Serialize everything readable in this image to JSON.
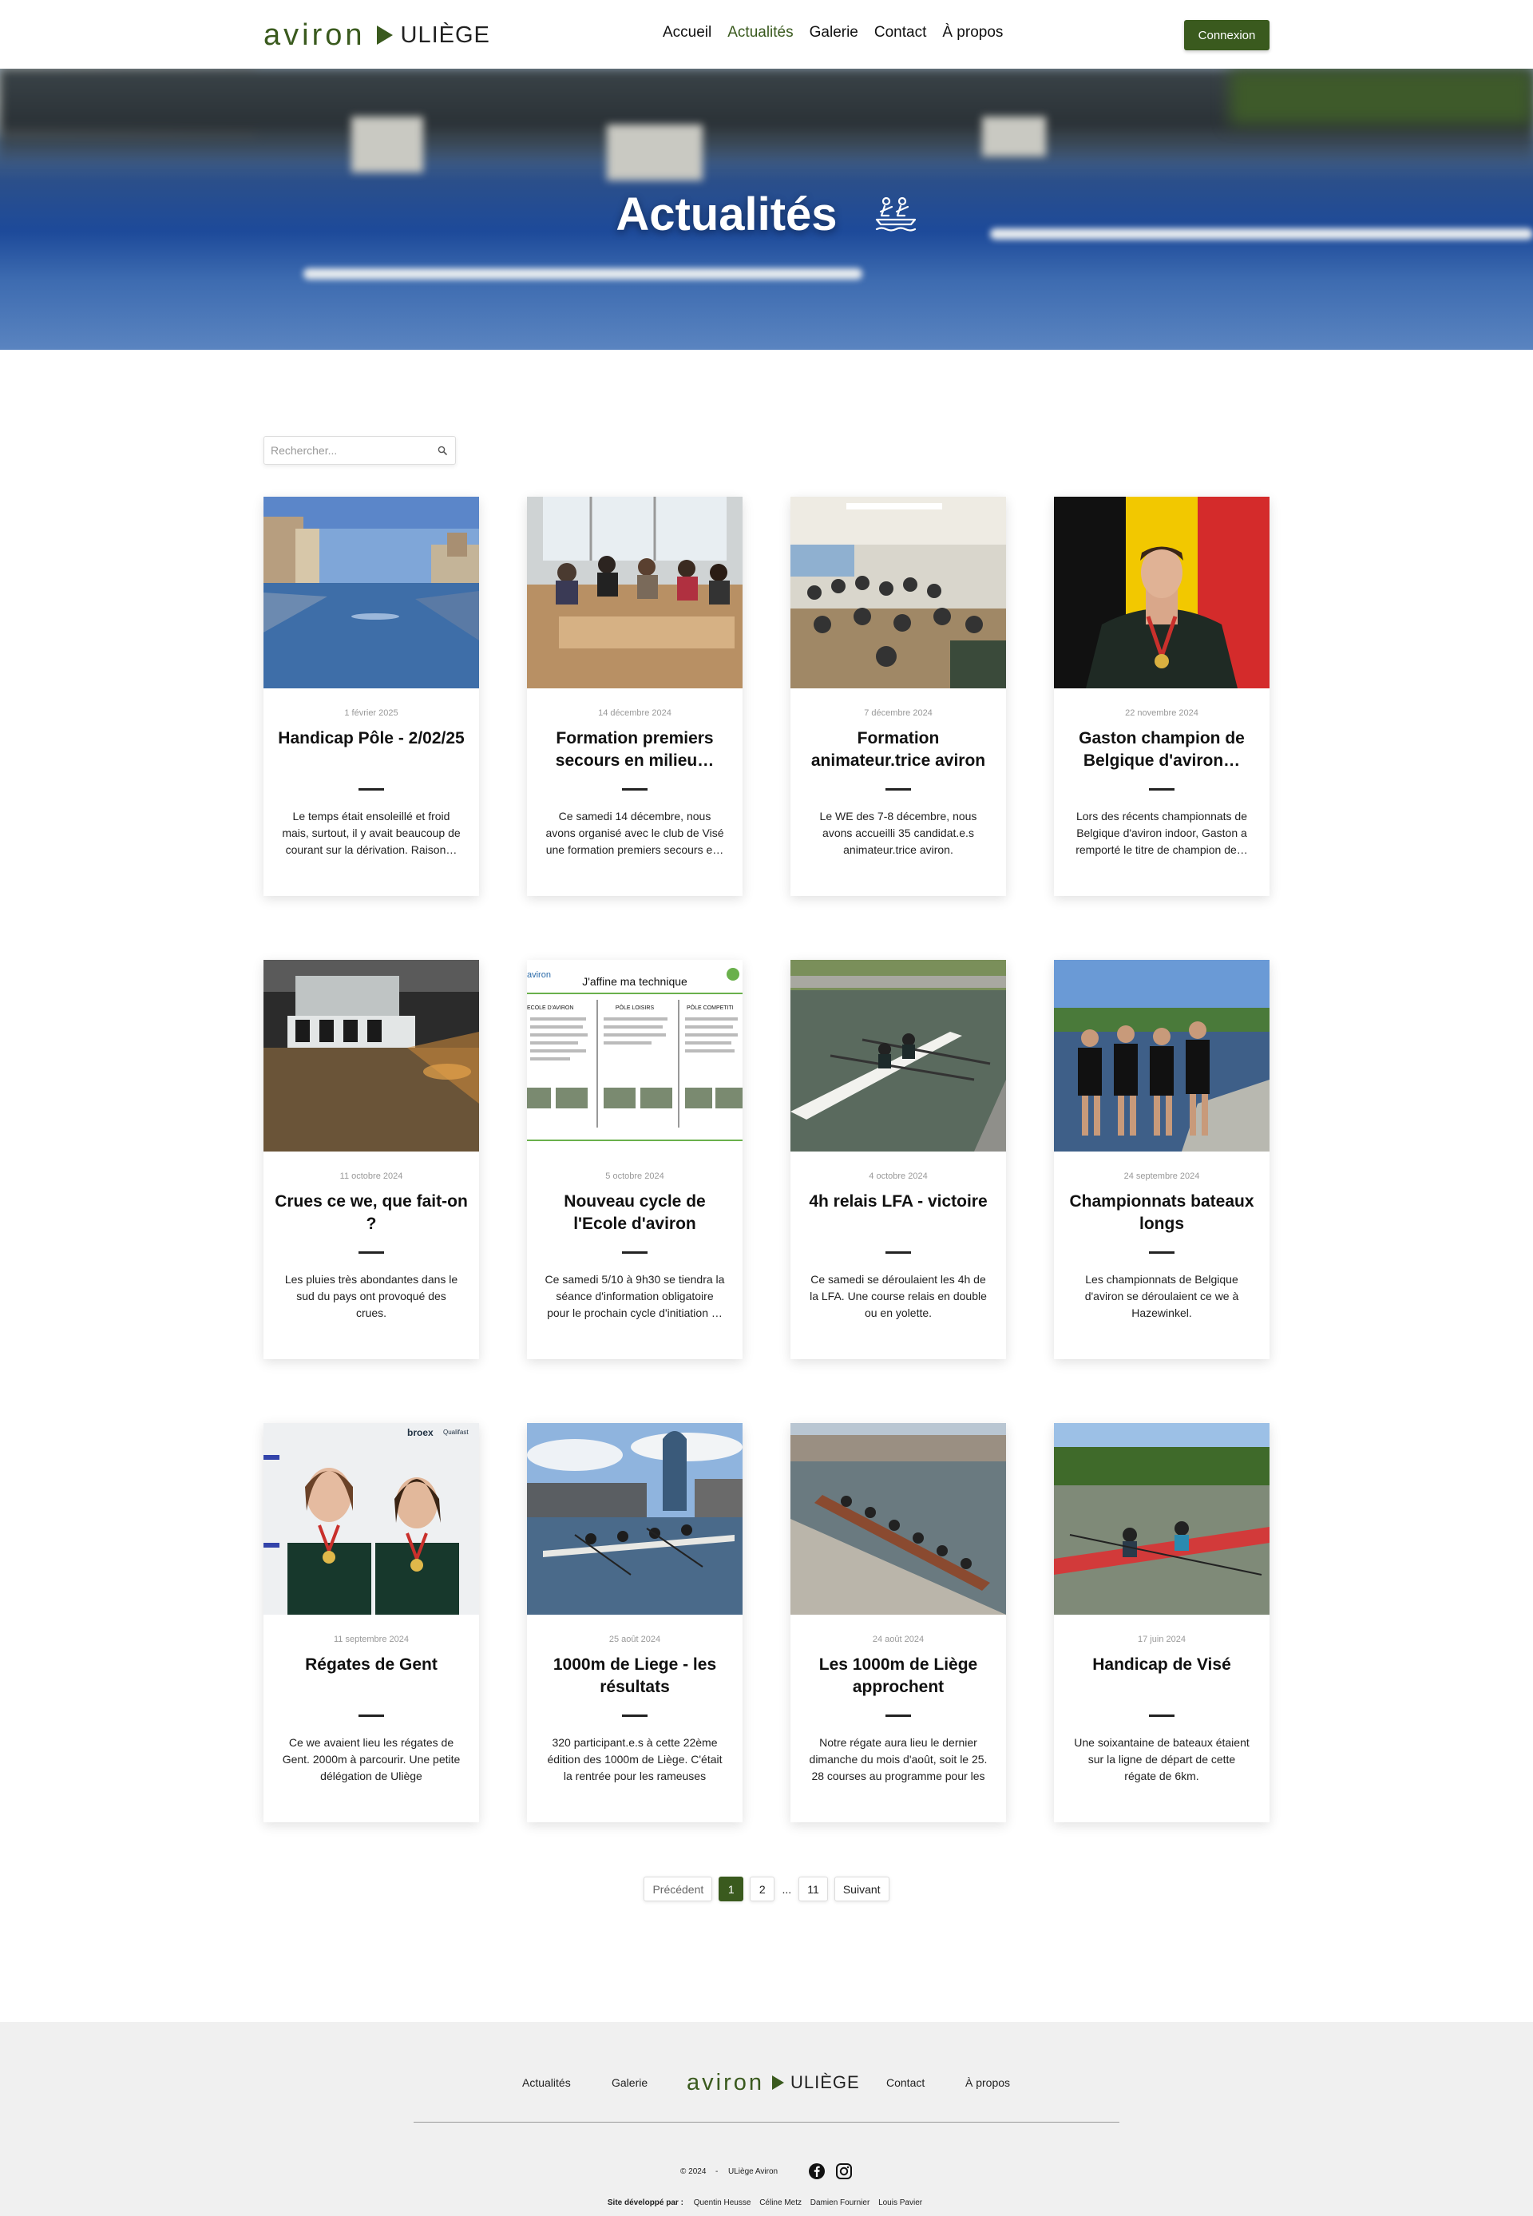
{
  "header": {
    "logo_main": "aviron",
    "logo_sub": "ULIÈGE",
    "nav": [
      "Accueil",
      "Actualités",
      "Galerie",
      "Contact",
      "À propos"
    ],
    "active_nav": "Actualités",
    "login_label": "Connexion"
  },
  "hero": {
    "title": "Actualités",
    "icon": "rowing-boat-icon"
  },
  "search": {
    "placeholder": "Rechercher..."
  },
  "articles": [
    {
      "date": "1 février 2025",
      "title": "Handicap Pôle - 2/02/25",
      "excerpt": "Le temps était ensoleillé et froid mais, surtout, il y avait beaucoup de courant sur la dérivation. Raison…"
    },
    {
      "date": "14 décembre 2024",
      "title": "Formation premiers secours en milieu…",
      "excerpt": "Ce samedi 14 décembre, nous avons organisé avec le club de Visé une formation premiers secours e…"
    },
    {
      "date": "7 décembre 2024",
      "title": "Formation animateur.trice aviron",
      "excerpt": "Le WE des 7-8 décembre, nous avons accueilli 35 candidat.e.s animateur.trice aviron."
    },
    {
      "date": "22 novembre 2024",
      "title": "Gaston champion de Belgique d'aviron…",
      "excerpt": "Lors des récents championnats de Belgique d'aviron indoor, Gaston a remporté le titre de champion de…"
    },
    {
      "date": "11 octobre 2024",
      "title": "Crues ce we, que fait-on ?",
      "excerpt": "Les pluies très abondantes dans le sud du pays ont provoqué des crues."
    },
    {
      "date": "5 octobre 2024",
      "title": "Nouveau cycle de l'Ecole d'aviron",
      "excerpt": "Ce samedi 5/10 à 9h30 se tiendra la séance d'information obligatoire pour le prochain cycle d'initiation …"
    },
    {
      "date": "4 octobre 2024",
      "title": "4h relais LFA - victoire",
      "excerpt": "Ce samedi se déroulaient les 4h de la LFA. Une course relais en double ou en yolette."
    },
    {
      "date": "24 septembre 2024",
      "title": "Championnats bateaux longs",
      "excerpt": "Les championnats de Belgique d'aviron se déroulaient ce we à Hazewinkel."
    },
    {
      "date": "11 septembre 2024",
      "title": "Régates de Gent",
      "excerpt": "Ce we avaient lieu les régates de Gent. 2000m à parcourir. Une petite délégation de Uliège"
    },
    {
      "date": "25 août 2024",
      "title": "1000m de Liege - les résultats",
      "excerpt": "320 participant.e.s à cette 22ème édition des 1000m de Liège. C'était la rentrée pour les rameuses"
    },
    {
      "date": "24 août 2024",
      "title": "Les 1000m de Liège approchent",
      "excerpt": "Notre régate aura lieu le dernier dimanche du mois d'août, soit le 25. 28 courses au programme pour les"
    },
    {
      "date": "17 juin 2024",
      "title": "Handicap de Visé",
      "excerpt": "Une soixantaine de bateaux étaient sur la ligne de départ de cette régate de 6km."
    }
  ],
  "poster": {
    "brand": "aviron",
    "heading": "J'affine ma technique",
    "columns": [
      "ECOLE D'AVIRON",
      "PÔLE LOISIRS",
      "PÔLE COMPETITI"
    ]
  },
  "photo_text": {
    "banner_brand": "broex",
    "banner_sponsor": "Qualifast"
  },
  "pagination": {
    "prev": "Précédent",
    "pages": [
      "1",
      "2"
    ],
    "ellipsis": "...",
    "last": "11",
    "next": "Suivant",
    "current": "1"
  },
  "footer": {
    "links": [
      "Actualités",
      "Galerie",
      "Contact",
      "À propos"
    ],
    "logo_main": "aviron",
    "logo_sub": "ULIÈGE",
    "copyright": "© 2024",
    "separator": "-",
    "org": "ULiège Aviron",
    "social": [
      "facebook-icon",
      "instagram-icon"
    ],
    "dev_label": "Site développé par :",
    "developers": [
      "Quentin Heusse",
      "Céline Metz",
      "Damien Fournier",
      "Louis Pavier"
    ]
  },
  "colors": {
    "brand_green": "#3a5a1e",
    "text": "#111111",
    "footer_bg": "#f0f0f0"
  }
}
